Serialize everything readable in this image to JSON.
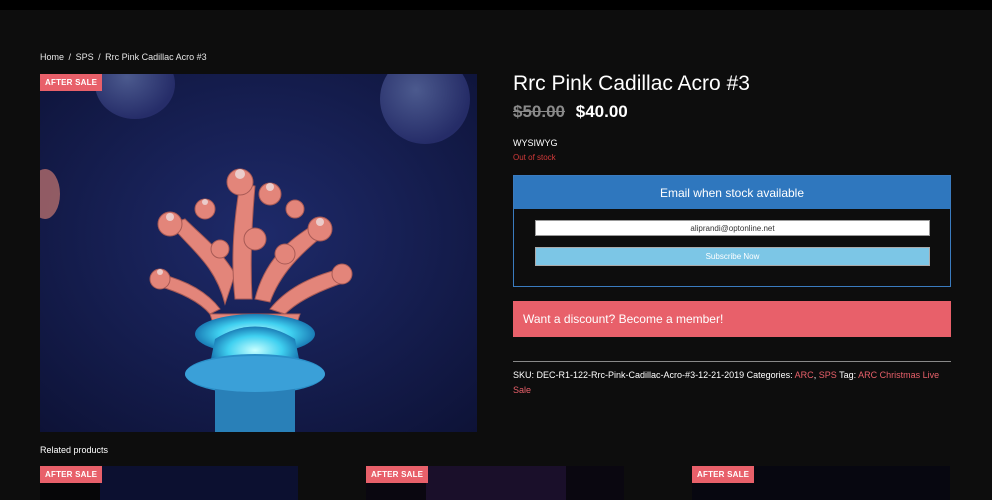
{
  "breadcrumb": {
    "home": "Home",
    "sep1": "/",
    "category": "SPS",
    "sep2": "/",
    "current": "Rrc Pink Cadillac Acro #3"
  },
  "badges": {
    "main": "AFTER SALE",
    "related1": "AFTER SALE",
    "related2": "AFTER SALE",
    "related3": "AFTER SALE"
  },
  "product": {
    "title": "Rrc Pink Cadillac Acro #3",
    "old_price": "$50.00",
    "new_price": "$40.00",
    "wysiwyg": "WYSIWYG",
    "stock_status": "Out of stock"
  },
  "notify": {
    "header": "Email when stock available",
    "email_value": "aliprandi@optonline.net",
    "subscribe_label": "Subscribe Now"
  },
  "discount": {
    "label": "Want a discount? Become a member!"
  },
  "meta": {
    "sku_label": "SKU:",
    "sku_value": "DEC-R1-122-Rrc-Pink-Cadillac-Acro-#3-12-21-2019",
    "categories_label": "Categories:",
    "category1": "ARC",
    "cat_sep": ",",
    "category2": "SPS",
    "tag_label": "Tag:",
    "tag1": "ARC Christmas Live Sale"
  },
  "related": {
    "title": "Related products"
  },
  "colors": {
    "accent_red": "#e8606a",
    "notify_blue": "#2f77be",
    "subscribe_blue": "#7cc6e6",
    "stock_red": "#d23a3a"
  }
}
